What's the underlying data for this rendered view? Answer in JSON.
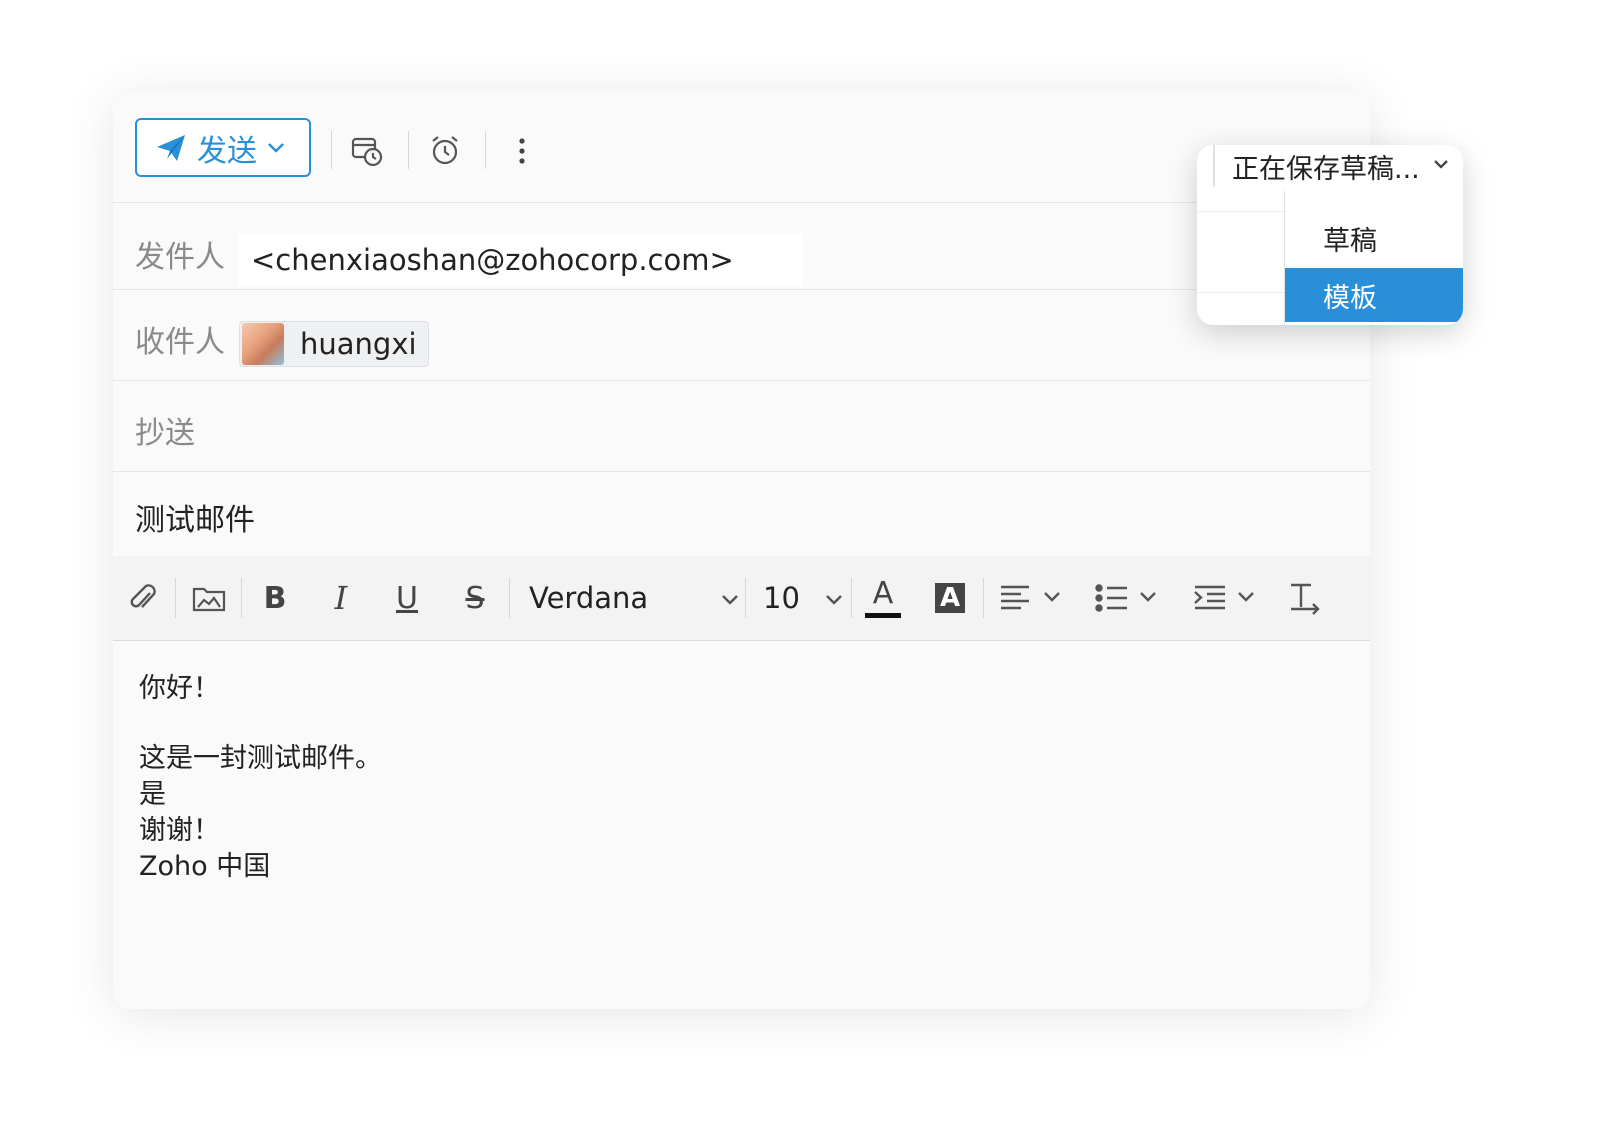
{
  "toolbar": {
    "send_label": "发送"
  },
  "compose": {
    "from_label": "发件人",
    "from_value": "<chenxiaoshan@zohocorp.com>",
    "to_label": "收件人",
    "to_recipient": "huangxi",
    "cc_label": "抄送",
    "subject": "测试邮件"
  },
  "format": {
    "font": "Verdana",
    "size": "10"
  },
  "body": {
    "lines": [
      "你好！",
      "",
      "",
      "这是一封测试邮件。",
      "是",
      "",
      "谢谢！",
      "Zoho 中国"
    ]
  },
  "save_menu": {
    "status": "正在保存草稿...",
    "items": [
      "草稿",
      "模板"
    ],
    "selected": "模板"
  },
  "colors": {
    "accent": "#2a8fd9"
  }
}
